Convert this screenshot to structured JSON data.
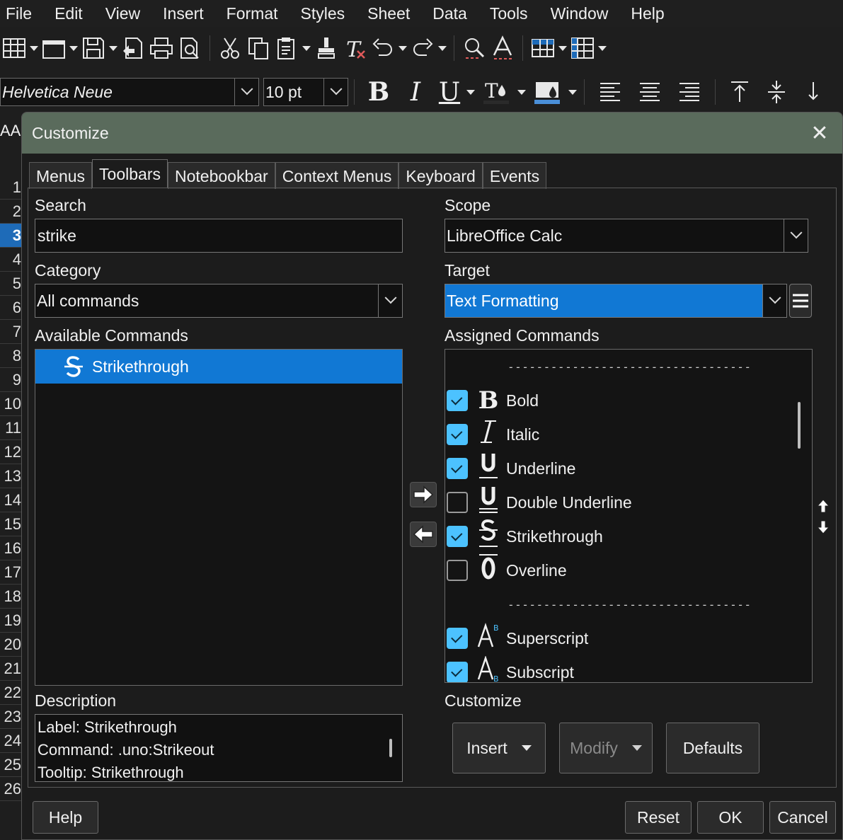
{
  "menubar": {
    "items": [
      "File",
      "Edit",
      "View",
      "Insert",
      "Format",
      "Styles",
      "Sheet",
      "Data",
      "Tools",
      "Window",
      "Help"
    ]
  },
  "toolbar1": {
    "icons": [
      "table-icon",
      "open-folder-icon",
      "save-icon",
      "export-icon",
      "print-icon",
      "print-preview-icon",
      "cut-icon",
      "copy-icon",
      "paste-icon",
      "clone-formatting-icon",
      "clear-formatting-icon",
      "undo-icon",
      "redo-icon",
      "find-replace-icon",
      "spelling-icon",
      "headers-icon",
      "freeze-icon"
    ]
  },
  "toolbar2": {
    "font_name": "Helvetica Neue",
    "font_size": "10 pt",
    "bold_glyph": "B",
    "italic_glyph": "I",
    "underline_glyph": "U"
  },
  "sheet": {
    "name_box_fragment": "AA",
    "row_numbers": [
      "1",
      "2",
      "3",
      "4",
      "5",
      "6",
      "7",
      "8",
      "9",
      "10",
      "11",
      "12",
      "13",
      "14",
      "15",
      "16",
      "17",
      "18",
      "19",
      "20",
      "21",
      "22",
      "23",
      "24",
      "25",
      "26"
    ],
    "selected_row": "3"
  },
  "dialog": {
    "title": "Customize",
    "close_glyph": "✕",
    "tabs": [
      "Menus",
      "Toolbars",
      "Notebookbar",
      "Context Menus",
      "Keyboard",
      "Events"
    ],
    "active_tab": "Toolbars",
    "search": {
      "label": "Search",
      "value": "strike"
    },
    "category": {
      "label": "Category",
      "value": "All commands"
    },
    "available": {
      "label": "Available Commands",
      "items": [
        {
          "label": "Strikethrough",
          "icon": "strikethrough-icon",
          "selected": true
        }
      ]
    },
    "scope": {
      "label": "Scope",
      "value": "LibreOffice Calc"
    },
    "target": {
      "label": "Target",
      "value": "Text Formatting"
    },
    "assigned": {
      "label": "Assigned Commands",
      "separator": "----------------------------------",
      "items": [
        {
          "type": "separator"
        },
        {
          "label": "Bold",
          "checked": true,
          "icon": "bold-icon"
        },
        {
          "label": "Italic",
          "checked": true,
          "icon": "italic-icon"
        },
        {
          "label": "Underline",
          "checked": true,
          "icon": "underline-icon"
        },
        {
          "label": "Double Underline",
          "checked": false,
          "icon": "double-underline-icon"
        },
        {
          "label": "Strikethrough",
          "checked": true,
          "icon": "strikethrough-icon"
        },
        {
          "label": "Overline",
          "checked": false,
          "icon": "overline-icon"
        },
        {
          "type": "separator"
        },
        {
          "label": "Superscript",
          "checked": true,
          "icon": "superscript-icon"
        },
        {
          "label": "Subscript",
          "checked": true,
          "icon": "subscript-icon"
        }
      ]
    },
    "description": {
      "label": "Description",
      "line1": "Label: Strikethrough",
      "line2": "Command: .uno:Strikeout",
      "line3": "Tooltip: Strikethrough"
    },
    "customize": {
      "label": "Customize",
      "insert": "Insert",
      "modify": "Modify",
      "defaults": "Defaults"
    },
    "buttons": {
      "help": "Help",
      "reset": "Reset",
      "ok": "OK",
      "cancel": "Cancel"
    }
  },
  "colors": {
    "selection": "#1178d4",
    "checkbox": "#4cc2ff",
    "title_bar": "#5a6b5c"
  }
}
